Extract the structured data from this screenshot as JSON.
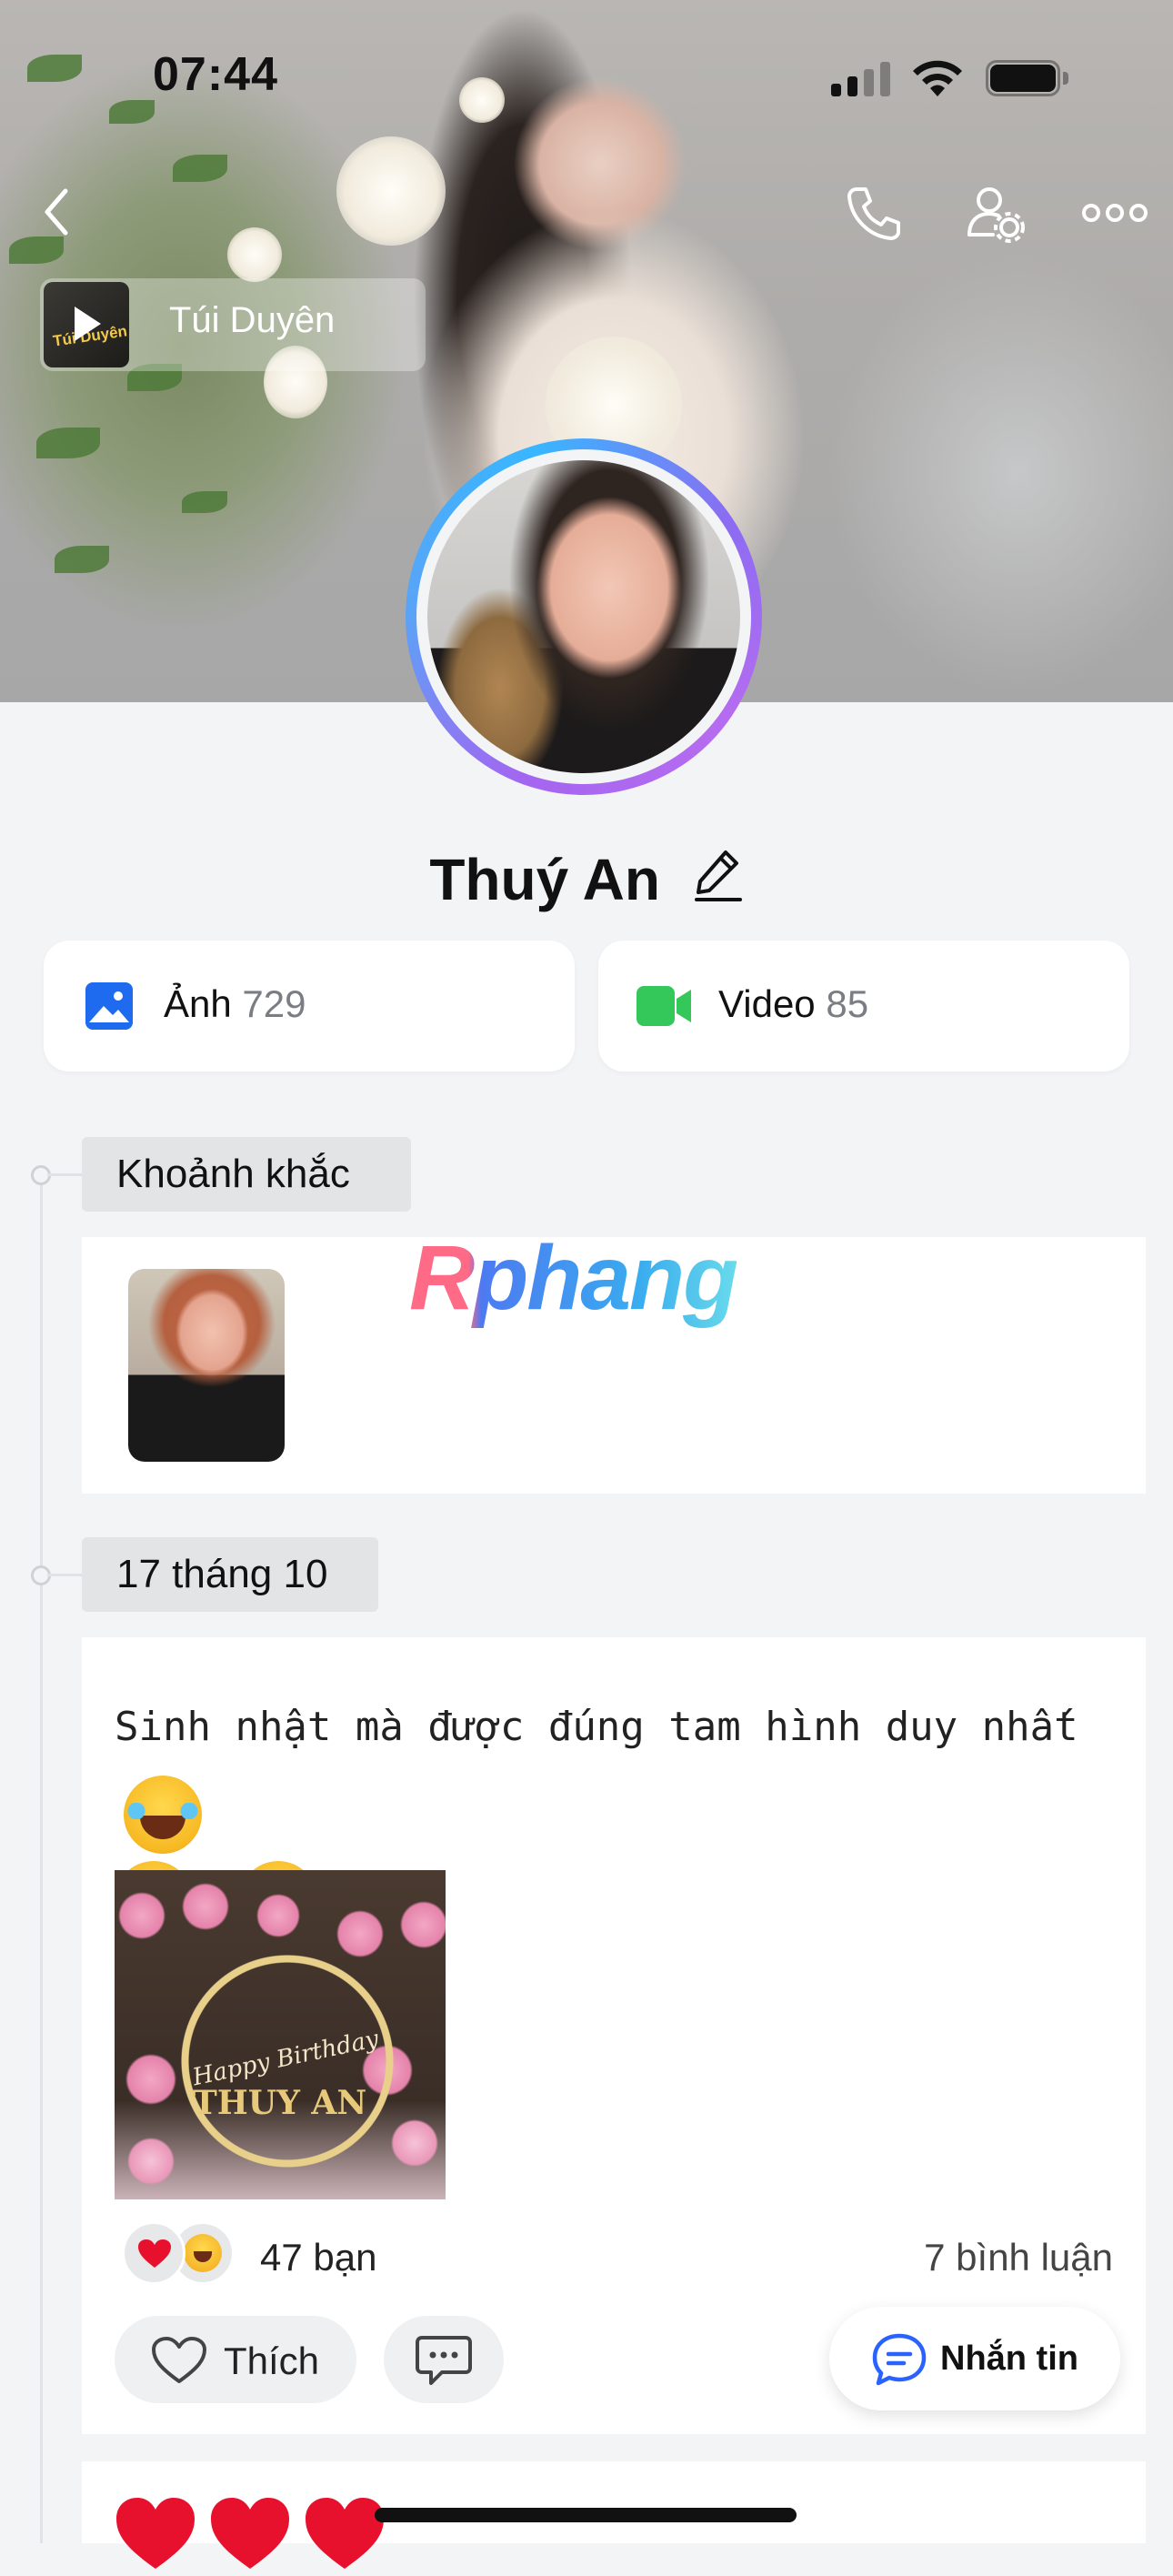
{
  "status_bar": {
    "time": "07:44"
  },
  "cover": {
    "music": {
      "album_art_text": "Túi Duyên",
      "title": "Túi Duyên"
    }
  },
  "profile": {
    "name": "Thuý An",
    "photos": {
      "label": "Ảnh",
      "count": "729"
    },
    "videos": {
      "label": "Video",
      "count": "85"
    }
  },
  "timeline": {
    "moments_label": "Khoảnh khắc",
    "watermark": "Rphang",
    "post": {
      "date": "17 tháng 10",
      "text": "Sinh nhật mà được đúng tam hình duy nhất",
      "photo_text": {
        "line1": "Happy Birthday",
        "line2": "THUY AN"
      },
      "reactions": "47 bạn",
      "comments": "7 bình luận",
      "like_label": "Thích"
    }
  },
  "chat_button": {
    "label": "Nhắn tin"
  },
  "colors": {
    "accent": "#2962ff",
    "video_green": "#34c759",
    "photo_blue": "#1e6bf0",
    "heart_red": "#e8112d"
  },
  "icons": [
    "back-chevron-icon",
    "phone-icon",
    "user-settings-icon",
    "more-icon",
    "play-icon",
    "edit-pencil-icon",
    "photo-icon",
    "video-camera-icon",
    "heart-outline-icon",
    "comment-icon",
    "chat-bubble-icon"
  ]
}
